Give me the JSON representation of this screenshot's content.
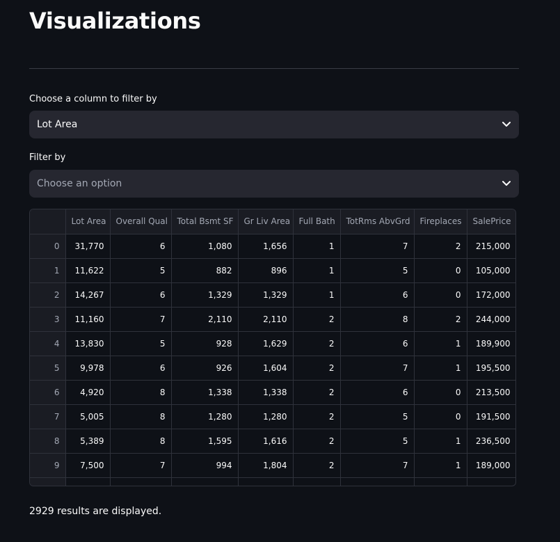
{
  "page": {
    "title": "Visualizations"
  },
  "filter_column": {
    "label": "Choose a column to filter by",
    "value": "Lot Area"
  },
  "filter_by": {
    "label": "Filter by",
    "placeholder": "Choose an option"
  },
  "table": {
    "columns": [
      "",
      "Lot Area",
      "Overall Qual",
      "Total Bsmt SF",
      "Gr Liv Area",
      "Full Bath",
      "TotRms AbvGrd",
      "Fireplaces",
      "SalePrice"
    ],
    "rows": [
      [
        "0",
        "31,770",
        "6",
        "1,080",
        "1,656",
        "1",
        "7",
        "2",
        "215,000"
      ],
      [
        "1",
        "11,622",
        "5",
        "882",
        "896",
        "1",
        "5",
        "0",
        "105,000"
      ],
      [
        "2",
        "14,267",
        "6",
        "1,329",
        "1,329",
        "1",
        "6",
        "0",
        "172,000"
      ],
      [
        "3",
        "11,160",
        "7",
        "2,110",
        "2,110",
        "2",
        "8",
        "2",
        "244,000"
      ],
      [
        "4",
        "13,830",
        "5",
        "928",
        "1,629",
        "2",
        "6",
        "1",
        "189,900"
      ],
      [
        "5",
        "9,978",
        "6",
        "926",
        "1,604",
        "2",
        "7",
        "1",
        "195,500"
      ],
      [
        "6",
        "4,920",
        "8",
        "1,338",
        "1,338",
        "2",
        "6",
        "0",
        "213,500"
      ],
      [
        "7",
        "5,005",
        "8",
        "1,280",
        "1,280",
        "2",
        "5",
        "0",
        "191,500"
      ],
      [
        "8",
        "5,389",
        "8",
        "1,595",
        "1,616",
        "2",
        "5",
        "1",
        "236,500"
      ],
      [
        "9",
        "7,500",
        "7",
        "994",
        "1,804",
        "2",
        "7",
        "1",
        "189,000"
      ]
    ]
  },
  "footer": {
    "text": "2929 results are displayed."
  },
  "icons": {
    "select_chevron": "chevron-down-icon"
  }
}
